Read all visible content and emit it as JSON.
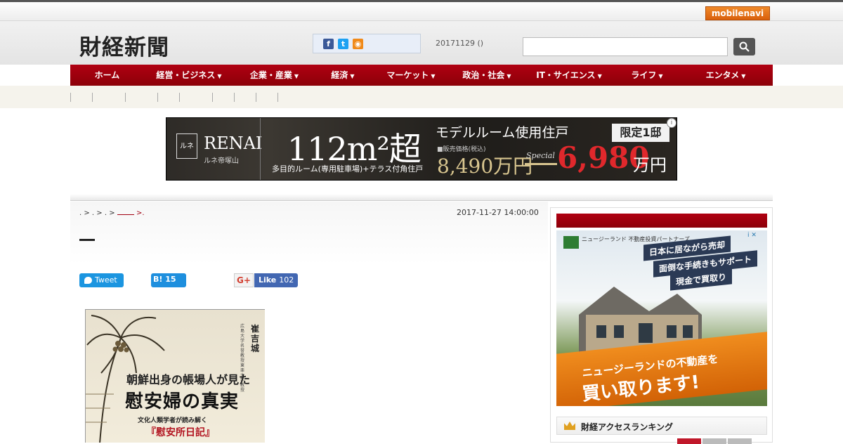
{
  "topbar": {
    "mobilenavi_label": "mobilenavi"
  },
  "header": {
    "logo": "財経新聞",
    "dateline": "20171129 ()",
    "search": {
      "placeholder": "",
      "value": ""
    }
  },
  "nav": {
    "items": [
      {
        "label": "ホーム",
        "dropdown": false
      },
      {
        "label": "経営・ビジネス",
        "dropdown": true
      },
      {
        "label": "企業・産業",
        "dropdown": true
      },
      {
        "label": "経済",
        "dropdown": true
      },
      {
        "label": "マーケット",
        "dropdown": true
      },
      {
        "label": "政治・社会",
        "dropdown": true
      },
      {
        "label": "IT・サイエンス",
        "dropdown": true
      },
      {
        "label": "ライフ",
        "dropdown": true
      },
      {
        "label": "エンタメ",
        "dropdown": true
      }
    ],
    "caret": "▼"
  },
  "ad_banner": {
    "logo_mark": "ルネ",
    "brand": "RENAI",
    "brand_sub": "ルネ帝塚山",
    "size": "112m²超",
    "size_sub": "多目的ルーム(専用駐車場)+テラス付角住戸",
    "model": "モデルルーム使用住戸",
    "limited": "限定1邸",
    "price_label": "■販売価格(税込)",
    "price_old": "8,490万円",
    "special": "Special",
    "price_new": "6,980",
    "price_unit": "万円",
    "info": "i"
  },
  "article": {
    "breadcrumb": ". > . > . >",
    "breadcrumb_tail": ">.",
    "date": "2017-11-27 14:00:00",
    "share": {
      "tweet": "Tweet",
      "hatena": "B! 15",
      "gplus": "G+",
      "like": "Like",
      "like_count": "102"
    },
    "book": {
      "author": "崔吉城",
      "author_sub": "広島大学名誉教授 東亜大学教授",
      "title1": "朝鮮出身の帳場人が見た",
      "title2": "慰安婦の真実",
      "title3": "文化人類学者が読み解く",
      "title4": "『慰安所日記』"
    }
  },
  "sidebar": {
    "ad": {
      "company": "ニュージーランド 不動産投資パートナーズ",
      "ad_choices": "i ✕",
      "tag1": "日本に居ながら売却",
      "tag2": "面倒な手続きもサポート",
      "tag3": "現金で買取り",
      "banner1": "ニュージーランドの不動産を",
      "banner2": "買い取ります!"
    },
    "ranking_title": "財経アクセスランキング"
  },
  "colors": {
    "nav_red": "#9e000d",
    "accent_orange": "#e07010",
    "tweet_blue": "#1b95e0",
    "facebook_blue": "#4267b2"
  }
}
